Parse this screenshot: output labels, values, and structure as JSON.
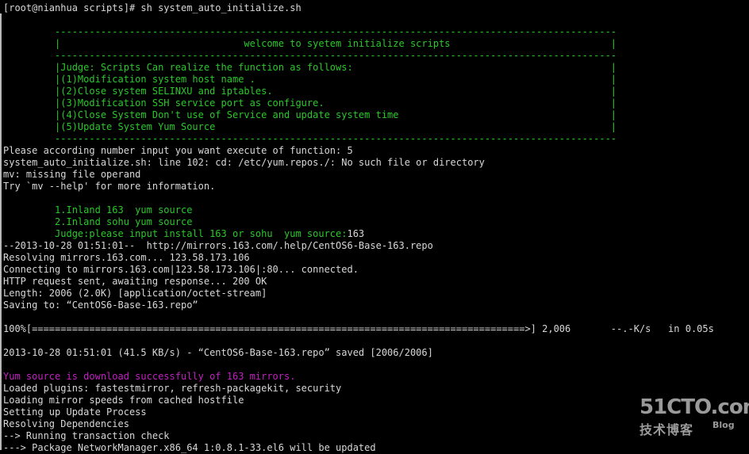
{
  "colors": {
    "background": "#000000",
    "text": "#d8d8d8",
    "green": "#2bc82b",
    "magenta": "#c020c0",
    "watermark": "#9a9a9a"
  },
  "terminal": {
    "prompt": "[root@nianhua scripts]# sh system_auto_initialize.sh",
    "banner_top_rule": "         --------------------------------------------------------------------------------------------------",
    "banner_title": "         |                                welcome to syetem initialize scripts                            |",
    "banner_mid_rule": "         --------------------------------------------------------------------------------------------------",
    "banner_judge": "         |Judge: Scripts Can realize the function as follows:                                             |",
    "banner_item_1": "         |(1)Modification system host name .                                                              |",
    "banner_item_2": "         |(2)Close system SELINXU and iptables.                                                           |",
    "banner_item_3": "         |(3)Modification SSH service port as configure.                                                  |",
    "banner_item_4": "         |(4)Close System Don't use of Service and update system time                                     |",
    "banner_item_5": "         |(5)Update System Yum Source                                                                     |",
    "banner_bottom_rule": "         --------------------------------------------------------------------------------------------------",
    "input_prompt": "Please according number input you want execute of function: 5",
    "error_cd": "system_auto_initialize.sh: line 102: cd: /etc/yum.repos./: No such file or directory",
    "error_mv": "mv: missing file operand",
    "error_mv_help": "Try `mv --help' for more information.",
    "source_option_1": "         1.Inland 163  yum source",
    "source_option_2": "         2.Inland sohu yum source",
    "source_judge_prompt": "         Judge:please input install 163 or sohu  yum source:",
    "source_judge_answer": "163",
    "wget_start": "--2013-10-28 01:51:01--  http://mirrors.163.com/.help/CentOS6-Base-163.repo",
    "wget_resolve": "Resolving mirrors.163.com... 123.58.173.106",
    "wget_connect": "Connecting to mirrors.163.com|123.58.173.106|:80... connected.",
    "wget_http": "HTTP request sent, awaiting response... 200 OK",
    "wget_length": "Length: 2006 (2.0K) [application/octet-stream]",
    "wget_saving": "Saving to: “CentOS6-Base-163.repo”",
    "wget_progress": "100%[======================================================================================>] 2,006       --.-K/s   in 0.05s",
    "wget_saved": "2013-10-28 01:51:01 (41.5 KB/s) - “CentOS6-Base-163.repo” saved [2006/2006]",
    "yum_success": "Yum source is download successfully of 163 mirrors.",
    "yum_plugins": "Loaded plugins: fastestmirror, refresh-packagekit, security",
    "yum_loading": "Loading mirror speeds from cached hostfile",
    "yum_setup": "Setting up Update Process",
    "yum_resolving": "Resolving Dependencies",
    "yum_check": "--> Running transaction check",
    "yum_package": "---> Package NetworkManager.x86_64 1:0.8.1-33.el6 will be updated"
  },
  "watermark": {
    "logo": "51CTO.com",
    "subtitle": "技术博客",
    "blog": "Blog"
  }
}
